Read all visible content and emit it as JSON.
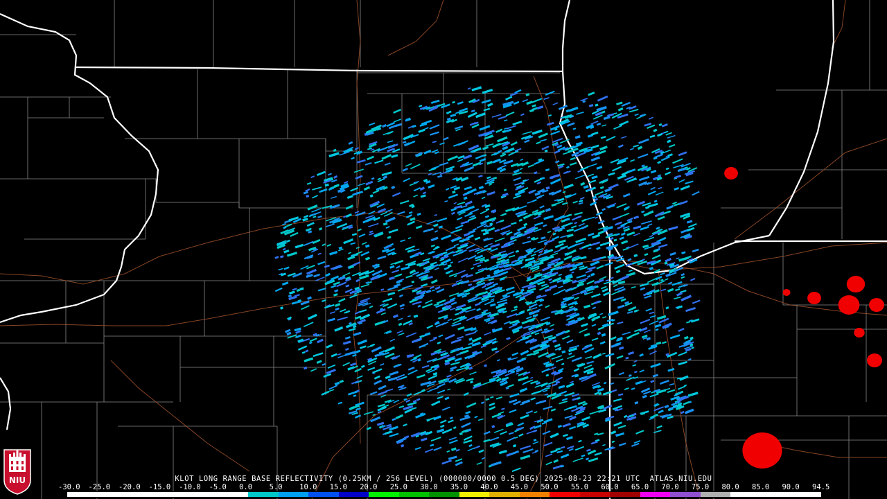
{
  "header": {
    "title": "KLOT LONG RANGE BASE REFLECTIVITY (0.25KM / 256 LEVEL) (000000/0000 0.5 DEG) 2025-08-23 22:21 UTC  ATLAS.NIU.EDU"
  },
  "colorbar": {
    "tick_labels": [
      "-30.0",
      "-25.0",
      "-20.0",
      "-15.0",
      "-10.0",
      "-5.0",
      "0.0",
      "5.0",
      "10.0",
      "15.0",
      "20.0",
      "25.0",
      "30.0",
      "35.0",
      "40.0",
      "45.0",
      "50.0",
      "55.0",
      "60.0",
      "65.0",
      "70.0",
      "75.0",
      "80.0",
      "85.0",
      "90.0",
      "94.5"
    ],
    "colors": [
      "#ffffff",
      "#ffffff",
      "#ffffff",
      "#ffffff",
      "#ffffff",
      "#ffffff",
      "#00c8c8",
      "#00a0f0",
      "#0050f0",
      "#0000c8",
      "#00f000",
      "#00c000",
      "#009000",
      "#f0f000",
      "#e0b000",
      "#f08000",
      "#f00000",
      "#c80000",
      "#a00000",
      "#f000f0",
      "#9050d0",
      "#b0b0b0",
      "#ffffff",
      "#ffffff",
      "#ffffff"
    ],
    "min": -30.0,
    "max": 94.5
  },
  "logo": {
    "text": "NIU",
    "colors": {
      "shield": "#c8102e",
      "ink": "#ffffff"
    }
  },
  "map_colors": {
    "state_border": "#ffffff",
    "county_line": "#8a8a8a",
    "road": "#a0522d",
    "background": "#000000"
  },
  "echo_colors": [
    "#00c8e0",
    "#00a8f0",
    "#1890f0",
    "#3070f0",
    "#00c8c8"
  ],
  "storm_colors": [
    "#00c8e0",
    "#00f000",
    "#00c000",
    "#f0f000",
    "#f08000",
    "#f00000"
  ]
}
